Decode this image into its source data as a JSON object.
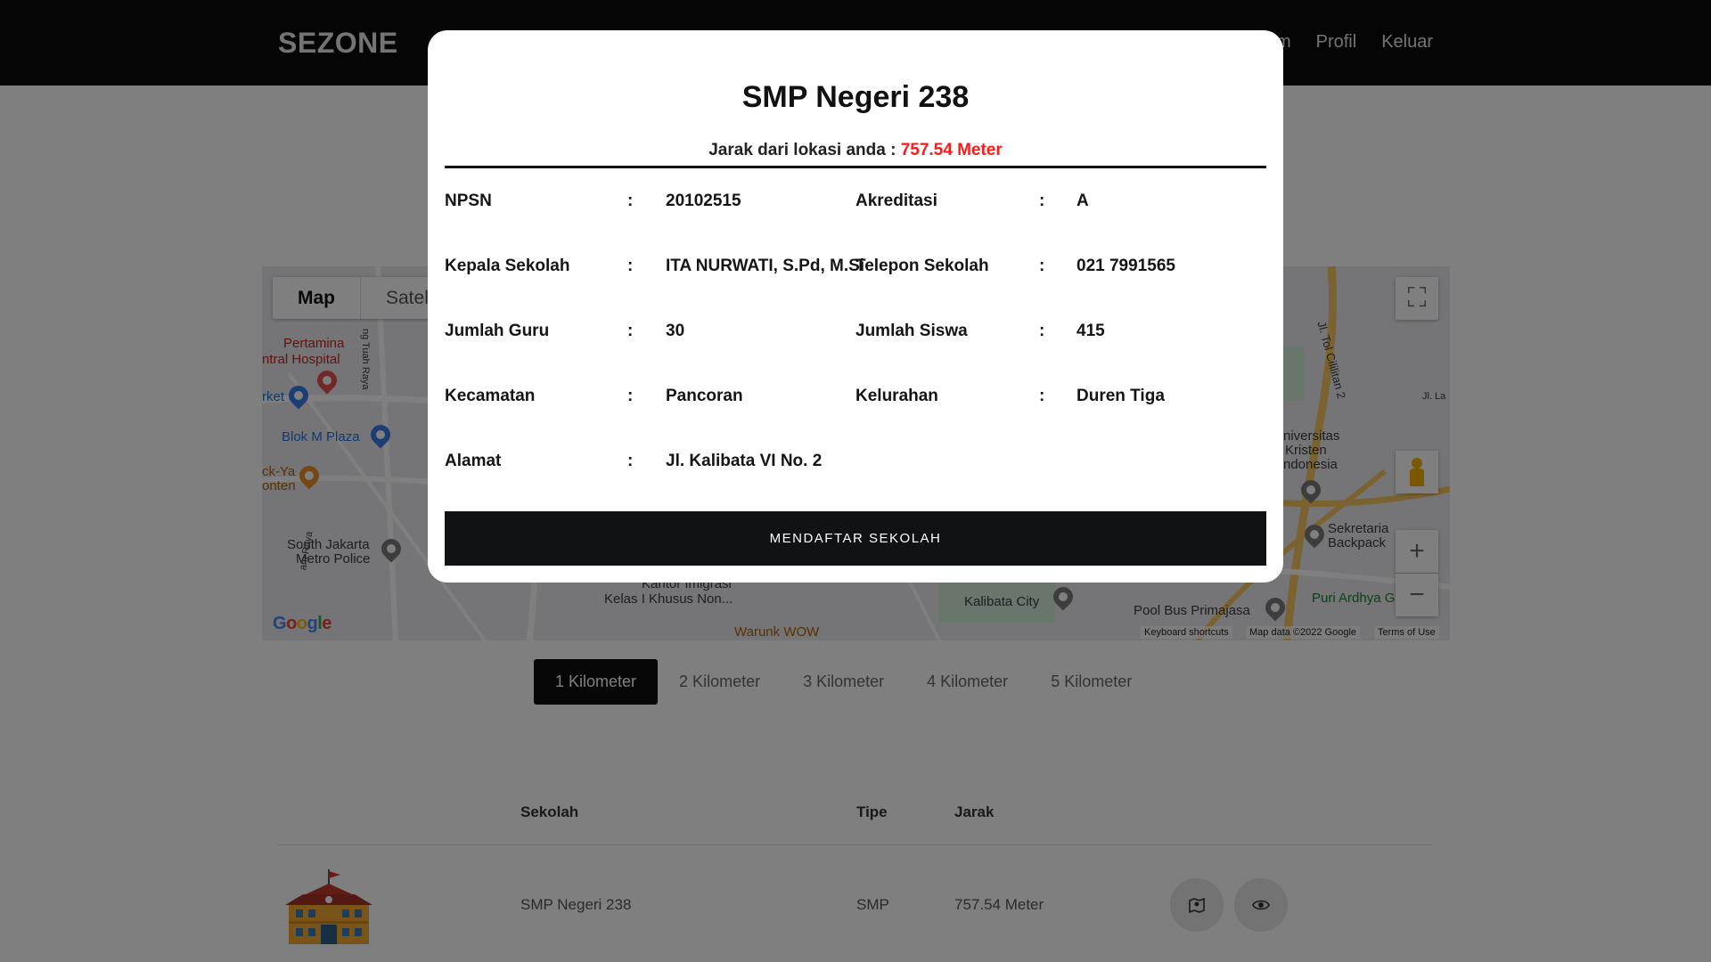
{
  "nav": {
    "brand": "SEZONE",
    "partial_link": "m",
    "links": [
      "Profil",
      "Keluar"
    ]
  },
  "map": {
    "type_active": "Map",
    "type_inactive": "Satel",
    "labels": {
      "pertamina": "Pertamina",
      "hospital": "ntral Hospital",
      "market": "rket",
      "blok_m": "Blok M Plaza",
      "pecel": "ck-Ya",
      "pecel2": "onten",
      "south_jakarta": "South Jakarta",
      "metro_police": "Metro Police",
      "kantor": "Kantor Imigrasi",
      "kelas": "Kelas I Khusus Non...",
      "warunk": "Warunk WOW",
      "kalibata": "Kalibata City",
      "poolbus": "Pool Bus Primajasa",
      "puri": "Puri Ardhya G",
      "universitas": "niversitas",
      "kristen": "Kristen",
      "indonesia": "ndonesia",
      "sekretariat": "Sekretaria",
      "backpack": "Backpack",
      "tol": "Jl. Tol Cililitan 2",
      "tuah": "ng Tuah Raya",
      "jlla": "Jl. La",
      "raya": "am Raya"
    },
    "footer": {
      "shortcuts": "Keyboard shortcuts",
      "data": "Map data ©2022 Google",
      "terms": "Terms of Use"
    }
  },
  "tabs": [
    "1 Kilometer",
    "2 Kilometer",
    "3 Kilometer",
    "4 Kilometer",
    "5 Kilometer"
  ],
  "table": {
    "headers": {
      "school": "Sekolah",
      "type": "Tipe",
      "distance": "Jarak"
    },
    "rows": [
      {
        "school": "SMP Negeri 238",
        "type": "SMP",
        "distance": "757.54 Meter"
      }
    ]
  },
  "modal": {
    "title": "SMP Negeri 238",
    "distance_label": "Jarak dari lokasi anda :",
    "distance_value": "757.54 Meter",
    "separator": ":",
    "fields": {
      "npsn_label": "NPSN",
      "npsn": "20102515",
      "akreditasi_label": "Akreditasi",
      "akreditasi": "A",
      "kepala_label": "Kepala Sekolah",
      "kepala": "ITA NURWATI, S.Pd, M.Si",
      "telepon_label": "Telepon Sekolah",
      "telepon": "021 7991565",
      "guru_label": "Jumlah Guru",
      "guru": "30",
      "siswa_label": "Jumlah Siswa",
      "siswa": "415",
      "kecamatan_label": "Kecamatan",
      "kecamatan": "Pancoran",
      "kelurahan_label": "Kelurahan",
      "kelurahan": "Duren Tiga",
      "alamat_label": "Alamat",
      "alamat": "Jl. Kalibata VI No. 2"
    },
    "button": "MENDAFTAR SEKOLAH"
  },
  "colors": {
    "accent_red": "#ff1a1a",
    "dark": "#0a0a0d"
  }
}
